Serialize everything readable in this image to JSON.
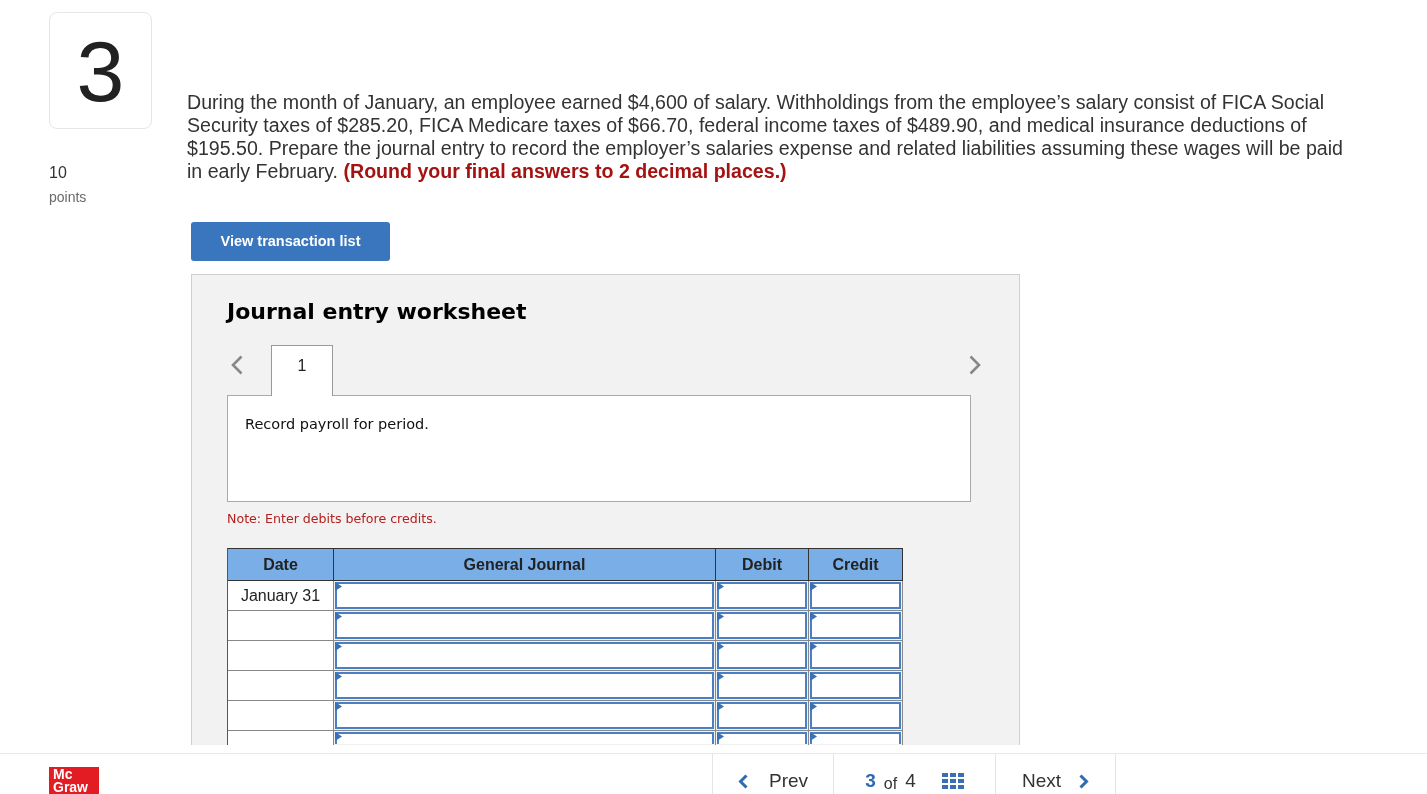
{
  "question": {
    "number": "3",
    "points": "10",
    "points_label": "points",
    "text": "During the month of January, an employee earned $4,600 of salary. Withholdings from the employee’s salary consist of FICA Social Security taxes of $285.20, FICA Medicare taxes of $66.70, federal income taxes of $489.90, and medical insurance deductions of $195.50. Prepare the journal entry to record the employer’s salaries expense and related liabilities assuming these wages will be paid in early February. **(Round your final answers to 2 decimal places.)**"
  },
  "transaction_button": {
    "label": "View transaction list"
  },
  "worksheet": {
    "title": "Journal entry worksheet",
    "tabs": [
      {
        "label": "1",
        "selected": true
      }
    ],
    "description": "Record payroll for period.",
    "note": "Note: Enter debits before credits.",
    "table": {
      "columns": [
        "Date",
        "General Journal",
        "Debit",
        "Credit"
      ],
      "rows": [
        {
          "date": "January 31"
        },
        {},
        {},
        {},
        {},
        {}
      ]
    }
  },
  "footer": {
    "logo": [
      "Mc",
      "Graw"
    ],
    "prev": "Prev",
    "position": {
      "current": "3",
      "of": "of",
      "total": "4"
    },
    "next": "Next"
  }
}
